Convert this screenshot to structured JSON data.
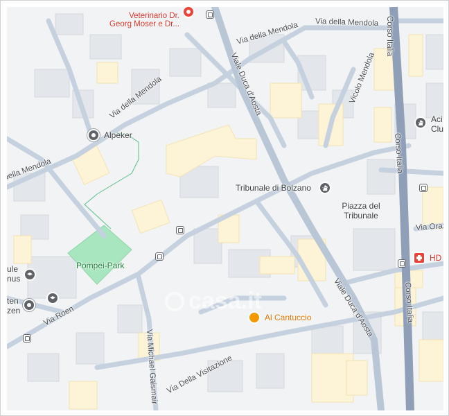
{
  "map": {
    "watermark": "casa.it",
    "colors": {
      "road": "#c5d1de",
      "main_road": "#8f9fb8",
      "block": "#e8eaed",
      "block_yellow": "#fdf3d6",
      "park": "#a8e6bf",
      "water": "#aadaff"
    },
    "places": {
      "vet": "Veterinario Dr. Georg Moser e Dr...",
      "alpeker": "Alpeker",
      "tribunale": "Tribunale di Bolzano",
      "piazza": "Piazza del Tribunale",
      "pompei_park": "Pompei-Park",
      "al_cantuccio": "Al Cantuccio",
      "scuola_partial": "ule nus",
      "scuola2_partial": "ten zen",
      "acli_partial": "Aci Clu",
      "hd_partial": "HD"
    },
    "streets": {
      "via_mendola_top": "Via della Mendola",
      "via_mendola_top2": "Via della Mendola",
      "via_mendola_left": "Via della Mendola",
      "via_mendola_far_left": "uella Mendola",
      "viale_duca_top": "Viale Duca d'Aosta",
      "viale_duca_bottom": "Viale Duca d'Aosta",
      "corso_italia_top": "Corso Italia",
      "corso_italia_mid": "Corso Italia",
      "corso_italia_bottom": "Corso Italia",
      "vicolo_mendola": "Vicolo Mendola",
      "via_roen": "Via Roen",
      "via_gaismair": "Via Michael Gaismair",
      "via_visitazione": "Via Della Visitazione",
      "via_oraz": "Via Oraz"
    }
  }
}
